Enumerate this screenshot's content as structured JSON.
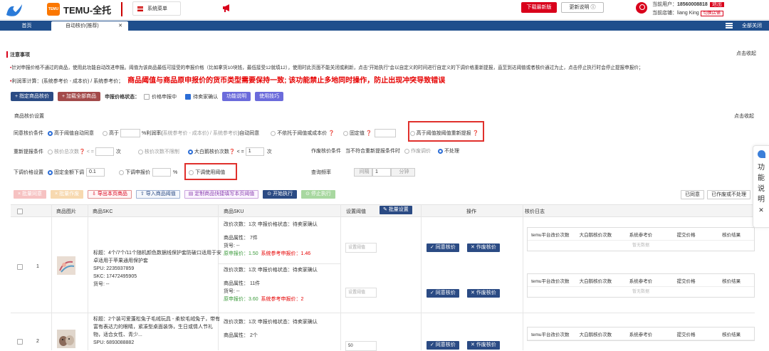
{
  "header": {
    "brand": "TEMU-全托",
    "logo_text": "TEMU",
    "sys_menu": "系统菜单",
    "download_btn": "下载最新版",
    "update_btn": "更新说明",
    "update_icon": "ⓘ",
    "current_user_label": "当前用户：",
    "current_user": "18560008818",
    "logout": "退出",
    "current_shop_label": "当前店铺：",
    "current_shop": "liang King",
    "switch_shop": "切换店铺"
  },
  "tabs": {
    "home": "首页",
    "active": "自动核价(推荐)",
    "close": "✕",
    "close_all": "全部关闭"
  },
  "notice": {
    "title": "注意事项",
    "collapse": "点击收起",
    "note1": "针对申报价格不通过的商品，使用此功能自动改进申报。阈值为该商品最低可接受的申报价格（比如拿货10块钱，最低接受12就填12），使用时此页面不能关闭或刷新，点击\"开始执行\"会以自定义的时间进行自定义的下调价格重新提报，直至到达阈值或者核价通过为止，点击停止执行时会停止提报申报价；",
    "note2": "利润率计算：(系统参考价 - 成本价) / 系统参考价；",
    "warn": "商品阈值与商品原申报价的货币类型需要保持一致;    该功能禁止多地同时操作，防止出现冲突导致错误"
  },
  "actions": {
    "assign": "+ 指定商品核价",
    "add_all": "+ 加载全部商品",
    "status_label": "申报价格状态：",
    "opt_pending": "价格申报中",
    "opt_confirm": "待卖家确认",
    "func_desc": "功能说明",
    "tips": "使用技巧"
  },
  "settings": {
    "title": "商品核价设置",
    "collapse": "点击收起",
    "agree_label": "同意核价条件",
    "agree_opts": {
      "o1": "高于阈值自动同意",
      "o2": "高于",
      "o2_suffix": "%利润率(",
      "o2_note": "系统参考价 - 成本价) / 系统参考价",
      "o2_end": ")自动同意",
      "o3": "不依托于阈值或成本价",
      "o4": "固定值",
      "o5": "高于阈值按阈值重新提报"
    },
    "resubmit_label": "重新提报条件",
    "resubmit_opts": {
      "o1": "核价总次数",
      "lt": "< =",
      "unit": "次",
      "o2": "核价次数不限制",
      "o3": "大白鹅核价次数",
      "lt2": "< =",
      "val2": "1",
      "unit2": "次"
    },
    "void_label": "作废核价条件",
    "void_desc": "当不符合重新提报条件时",
    "void_opts": {
      "o1": "作废调价",
      "o2": "不处理"
    },
    "down_label": "下调价格设置",
    "down_opts": {
      "o1": "固定金额下调",
      "val1": "0.1",
      "o2": "下调申报价",
      "pct": "%",
      "o3": "下调使用阈值"
    },
    "freq_label": "查询频率",
    "freq_prefix": "间隔",
    "freq_val": "1",
    "freq_unit": "分钟"
  },
  "toolbar": {
    "b1": "× 批量同意",
    "b2": "× 批量作废",
    "b3": "⇩ 导出本页商品",
    "b4": "⇧ 导入商品阈值",
    "b5": "▤ 定制商品快捷填写本页阈值",
    "b6": "⊙ 开始执行",
    "b7": "⊙ 停止执行",
    "r1": "已同意",
    "r2": "已作废或不处理"
  },
  "table": {
    "cols": {
      "img": "商品图片",
      "skc": "商品SKC",
      "sku": "商品SKU",
      "thr": "设置阈值",
      "bulk": "批量设置",
      "act": "操作",
      "log": "核价日志"
    },
    "log_cols": [
      "temu平台改价次数",
      "大白鹅核价次数",
      "系统参考价",
      "提交价格",
      "核价结果"
    ],
    "log_empty": "暂无数据",
    "agree_btn": "✓ 同意核价",
    "void_btn": "✕ 作废核价",
    "thr_placeholder": "设置阈值",
    "rows": [
      {
        "idx": "1",
        "title": "标题：4个/7个/11个随机颜色数据线保护套防破口适用于安卓适用于苹果通用保护套",
        "spu": "SPU: 2235937859",
        "skc": "SKC: 17472495905",
        "sku_no": "货号: --",
        "skus": [
          {
            "info": "改价次数：1次 申报价格状态：待卖家确认",
            "attr": "商品属性： 7件",
            "no": "货号: --",
            "orig": "原申报价：1.50",
            "ref": "系统参考申报价：1.46"
          },
          {
            "info": "改价次数：1次 申报价格状态：待卖家确认",
            "attr": "商品属性： 11件",
            "no": "货号: --",
            "orig": "原申报价：3.60",
            "ref": "系统参考申报价：2"
          }
        ]
      },
      {
        "idx": "2",
        "title": "标题：2个装可爱蓬松兔子毛绒玩具 - 柔软毛绒兔子，带有富有表达力的眼睛，紧凑型桌面装饰，生日或情人节礼物，适合女性、青少...",
        "spu": "SPU: 6893088882",
        "sku_info": "改价次数：1次 申报价格状态：待卖家确认",
        "sku_attr": "商品属性： 2个",
        "thr_val": "50"
      }
    ]
  },
  "floater": {
    "text": [
      "功",
      "能",
      "说",
      "明"
    ],
    "close": "✕"
  }
}
